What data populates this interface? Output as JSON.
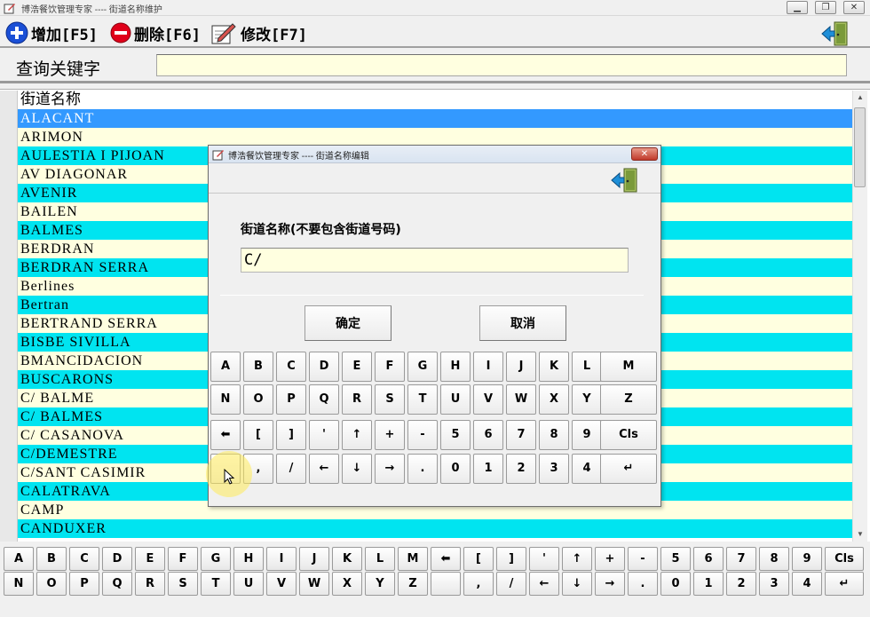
{
  "window": {
    "title": "博浩餐饮管理专家 ---- 街道名称维护",
    "controls": [
      "minimize-icon",
      "restore-icon",
      "close-icon"
    ]
  },
  "toolbar": {
    "add_label": "增加[F5]",
    "delete_label": "删除[F6]",
    "edit_label": "修改[F7]"
  },
  "search": {
    "label": "查询关键字",
    "value": ""
  },
  "list": {
    "header": "街道名称",
    "selected_index": 0,
    "rows": [
      "ALACANT",
      "ARIMON",
      "AULESTIA I PIJOAN",
      "AV DIAGONAR",
      "AVENIR",
      "BAILEN",
      "BALMES",
      "BERDRAN",
      "BERDRAN SERRA",
      "Berlines",
      "Bertran",
      "BERTRAND SERRA",
      "BISBE SIVILLA",
      "BMANCIDACION",
      "BUSCARONS",
      "C/ BALME",
      "C/ BALMES",
      "C/ CASANOVA",
      "C/DEMESTRE",
      "C/SANT CASIMIR",
      "CALATRAVA",
      "CAMP",
      "CANDUXER"
    ]
  },
  "keyboard_bottom": {
    "row1": [
      "A",
      "B",
      "C",
      "D",
      "E",
      "F",
      "G",
      "H",
      "I",
      "J",
      "K",
      "L",
      "M",
      "⬅",
      "[",
      "]",
      "'",
      "↑",
      "+",
      "-",
      "5",
      "6",
      "7",
      "8",
      "9",
      "Cls"
    ],
    "row2": [
      "N",
      "O",
      "P",
      "Q",
      "R",
      "S",
      "T",
      "U",
      "V",
      "W",
      "X",
      "Y",
      "Z",
      "",
      ",",
      "/",
      "←",
      "↓",
      "→",
      ".",
      "0",
      "1",
      "2",
      "3",
      "4",
      "↵"
    ]
  },
  "dialog": {
    "title": "博浩餐饮管理专家 ---- 街道名称编辑",
    "field_label": "街道名称(不要包含街道号码)",
    "field_value": "C/",
    "ok_label": "确定",
    "cancel_label": "取消",
    "keys": [
      [
        "A",
        "B",
        "C",
        "D",
        "E",
        "F",
        "G",
        "H",
        "I",
        "J",
        "K",
        "L",
        "M"
      ],
      [
        "N",
        "O",
        "P",
        "Q",
        "R",
        "S",
        "T",
        "U",
        "V",
        "W",
        "X",
        "Y",
        "Z"
      ],
      [
        "⬅",
        "[",
        "]",
        "'",
        "↑",
        "+",
        "-",
        "5",
        "6",
        "7",
        "8",
        "9",
        "Cls"
      ],
      [
        "",
        ",",
        "/",
        "←",
        "↓",
        "→",
        ".",
        "0",
        "1",
        "2",
        "3",
        "4",
        "↵"
      ]
    ]
  },
  "colors": {
    "row_cyan": "#00e4f0",
    "row_cream": "#ffffe0",
    "selected": "#3399ff",
    "add_icon": "#1a4fd6",
    "delete_icon": "#e0001a",
    "exit_door": "#7a9a3a"
  }
}
